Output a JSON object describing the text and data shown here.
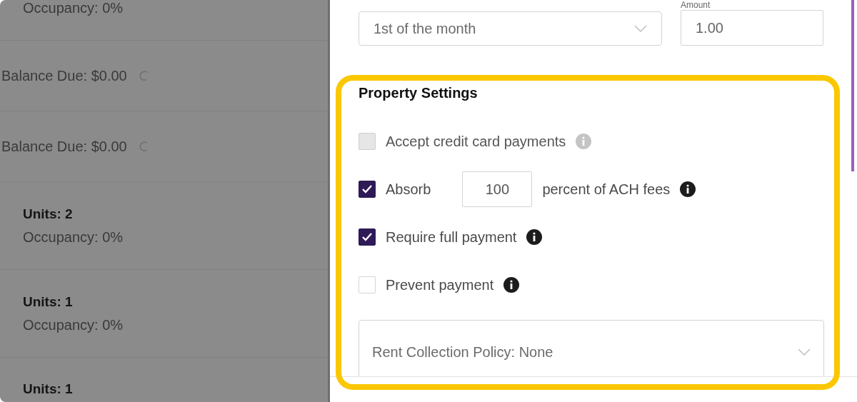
{
  "list_rows": [
    {
      "units": null,
      "occupancy": "Occupancy: 0%",
      "balance": null
    },
    {
      "units": null,
      "occupancy": null,
      "balance": "Balance Due: $0.00"
    },
    {
      "units": null,
      "occupancy": null,
      "balance": "Balance Due: $0.00"
    },
    {
      "units": "Units: 2",
      "occupancy": "Occupancy: 0%",
      "balance": null
    },
    {
      "units": "Units: 1",
      "occupancy": "Occupancy: 0%",
      "balance": null
    },
    {
      "units": "Units: 1",
      "occupancy": null,
      "balance": null
    }
  ],
  "due_day": {
    "value": "1st of the month"
  },
  "amount": {
    "label": "Amount",
    "value": "1.00"
  },
  "property_settings": {
    "title": "Property Settings",
    "options": [
      {
        "kind": "plain",
        "label": "Accept credit card payments",
        "checked": false,
        "disabled": true
      },
      {
        "kind": "absorb",
        "label": "Absorb",
        "value": "100",
        "suffix": "percent of ACH fees",
        "checked": true,
        "disabled": false
      },
      {
        "kind": "plain",
        "label": "Require full payment",
        "checked": true,
        "disabled": false
      },
      {
        "kind": "plain",
        "label": "Prevent payment",
        "checked": false,
        "disabled": false
      }
    ],
    "policy": {
      "value": "Rent Collection Policy: None"
    }
  }
}
